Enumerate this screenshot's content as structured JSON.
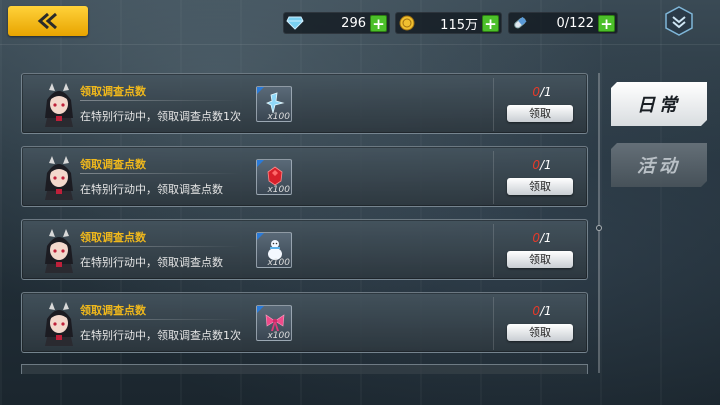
{
  "topbar": {
    "back_label": "back",
    "resources": [
      {
        "name": "diamond",
        "icon": "diamond-icon",
        "value": "296"
      },
      {
        "name": "coin",
        "icon": "coin-icon",
        "value": "115万"
      },
      {
        "name": "stamina",
        "icon": "capsule-icon",
        "value": "0/122"
      }
    ],
    "menu_icon": "chevron-menu-icon"
  },
  "tabs": [
    {
      "label": "日常",
      "active": true
    },
    {
      "label": "活动",
      "active": false
    }
  ],
  "tasks": [
    {
      "title": "领取调查点数",
      "desc": "在特别行动中，领取调查点数1次",
      "reward_icon": "crystal-shard-icon",
      "reward_qty": "x100",
      "progress_current": "0",
      "progress_total": "/1",
      "button": "领取"
    },
    {
      "title": "领取调查点数",
      "desc": "在特别行动中，领取调查点数",
      "reward_icon": "red-gem-icon",
      "reward_qty": "x100",
      "progress_current": "0",
      "progress_total": "/1",
      "button": "领取"
    },
    {
      "title": "领取调查点数",
      "desc": "在特别行动中，领取调查点数",
      "reward_icon": "snowman-icon",
      "reward_qty": "x100",
      "progress_current": "0",
      "progress_total": "/1",
      "button": "领取"
    },
    {
      "title": "领取调查点数",
      "desc": "在特别行动中，领取调查点数1次",
      "reward_icon": "ribbon-bow-icon",
      "reward_qty": "x100",
      "progress_current": "0",
      "progress_total": "/1",
      "button": "领取"
    }
  ],
  "colors": {
    "accent_gold": "#f0b81c",
    "back_button": "#ffc61a",
    "progress_red": "#e53a2a",
    "plus_green": "#4cc02a"
  }
}
